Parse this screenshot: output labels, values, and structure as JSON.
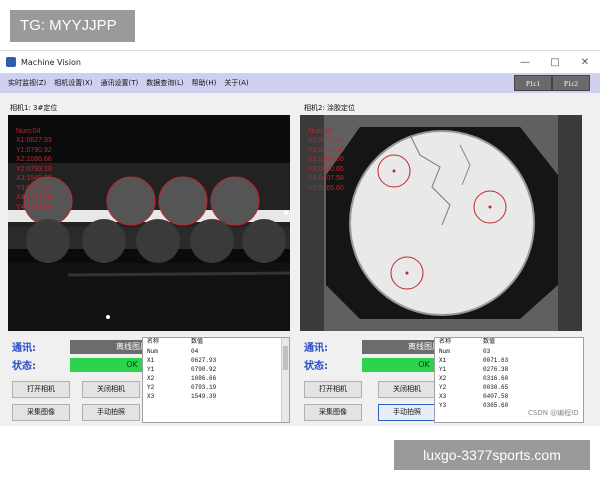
{
  "overlay_tag": "TG: MYYJJPP",
  "footer_tag": "luxgo-3377sports.com",
  "watermark": "CSDN @编程ID",
  "window": {
    "title": "Machine Vision",
    "controls": [
      "—",
      "□",
      "✕"
    ]
  },
  "menu": {
    "items": [
      "实时监视(Z)",
      "相机设置(X)",
      "通讯设置(T)",
      "数据查询(L)",
      "帮助(H)",
      "关于(A)"
    ],
    "tabs": [
      "P1c1",
      "P1c2"
    ]
  },
  "cameras": [
    {
      "label": "相机1:  3#定位",
      "overlay": [
        "Num:04",
        "X1:0627.93",
        "Y1:0790.92",
        "X2:1086.66",
        "Y2:0793.19",
        "X3:1549.39",
        "Y3:0790.89",
        "X4:2008.19",
        "Y4:0792.59"
      ],
      "comm_label": "通讯:",
      "comm_status": "离线图片",
      "state_label": "状态:",
      "state_value": "OK",
      "buttons": [
        "打开相机",
        "关闭相机",
        "采集图像",
        "手动拍照"
      ],
      "table": {
        "headers": [
          "名称",
          "数值"
        ],
        "rows": [
          [
            "Num",
            "04"
          ],
          [
            "X1",
            "0627.93"
          ],
          [
            "Y1",
            "0790.92"
          ],
          [
            "X2",
            "1086.66"
          ],
          [
            "Y2",
            "0793.19"
          ],
          [
            "X3",
            "1549.39"
          ]
        ]
      }
    },
    {
      "label": "相机2:  涂胶定位",
      "overlay": [
        "Num:03",
        "X1:0071.63",
        "Y1:0276.38",
        "X2:0316.60",
        "Y2:0030.65",
        "X3:0407.58",
        "Y3:0365.60"
      ],
      "comm_label": "通讯:",
      "comm_status": "离线图片",
      "state_label": "状态:",
      "state_value": "OK",
      "buttons": [
        "打开相机",
        "关闭相机",
        "采集图像",
        "手动拍照"
      ],
      "table": {
        "headers": [
          "名称",
          "数值"
        ],
        "rows": [
          [
            "Num",
            "03"
          ],
          [
            "X1",
            "0071.63"
          ],
          [
            "Y1",
            "0276.38"
          ],
          [
            "X2",
            "0316.60"
          ],
          [
            "Y2",
            "0030.65"
          ],
          [
            "X3",
            "0407.58"
          ],
          [
            "Y3",
            "0365.60"
          ]
        ]
      }
    }
  ],
  "colors": {
    "menubar": "#cfd0ef",
    "status_ok": "#2bd44a",
    "overlay_text": "#c2262e",
    "accent_label": "#2b4cc7"
  }
}
